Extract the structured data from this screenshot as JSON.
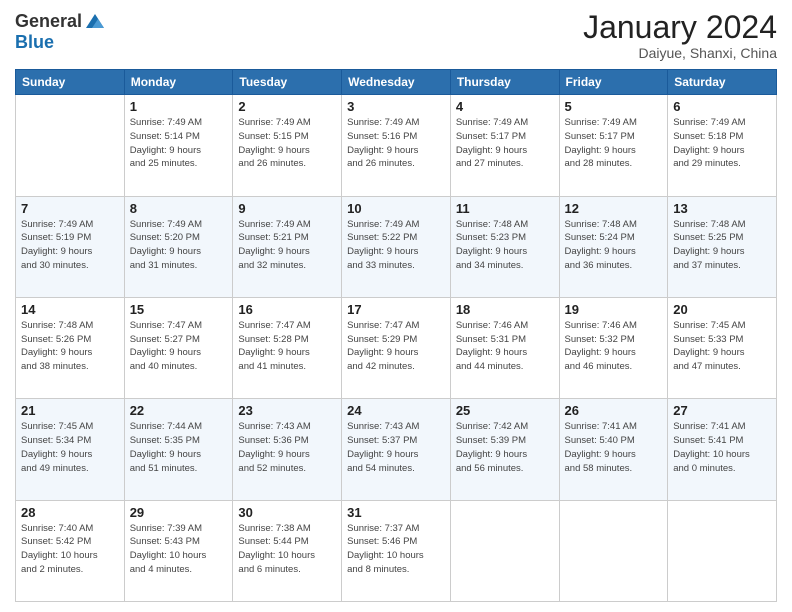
{
  "header": {
    "logo_general": "General",
    "logo_blue": "Blue",
    "month_title": "January 2024",
    "subtitle": "Daiyue, Shanxi, China"
  },
  "days_of_week": [
    "Sunday",
    "Monday",
    "Tuesday",
    "Wednesday",
    "Thursday",
    "Friday",
    "Saturday"
  ],
  "weeks": [
    [
      {
        "day": "",
        "info": ""
      },
      {
        "day": "1",
        "info": "Sunrise: 7:49 AM\nSunset: 5:14 PM\nDaylight: 9 hours\nand 25 minutes."
      },
      {
        "day": "2",
        "info": "Sunrise: 7:49 AM\nSunset: 5:15 PM\nDaylight: 9 hours\nand 26 minutes."
      },
      {
        "day": "3",
        "info": "Sunrise: 7:49 AM\nSunset: 5:16 PM\nDaylight: 9 hours\nand 26 minutes."
      },
      {
        "day": "4",
        "info": "Sunrise: 7:49 AM\nSunset: 5:17 PM\nDaylight: 9 hours\nand 27 minutes."
      },
      {
        "day": "5",
        "info": "Sunrise: 7:49 AM\nSunset: 5:17 PM\nDaylight: 9 hours\nand 28 minutes."
      },
      {
        "day": "6",
        "info": "Sunrise: 7:49 AM\nSunset: 5:18 PM\nDaylight: 9 hours\nand 29 minutes."
      }
    ],
    [
      {
        "day": "7",
        "info": "Sunrise: 7:49 AM\nSunset: 5:19 PM\nDaylight: 9 hours\nand 30 minutes."
      },
      {
        "day": "8",
        "info": "Sunrise: 7:49 AM\nSunset: 5:20 PM\nDaylight: 9 hours\nand 31 minutes."
      },
      {
        "day": "9",
        "info": "Sunrise: 7:49 AM\nSunset: 5:21 PM\nDaylight: 9 hours\nand 32 minutes."
      },
      {
        "day": "10",
        "info": "Sunrise: 7:49 AM\nSunset: 5:22 PM\nDaylight: 9 hours\nand 33 minutes."
      },
      {
        "day": "11",
        "info": "Sunrise: 7:48 AM\nSunset: 5:23 PM\nDaylight: 9 hours\nand 34 minutes."
      },
      {
        "day": "12",
        "info": "Sunrise: 7:48 AM\nSunset: 5:24 PM\nDaylight: 9 hours\nand 36 minutes."
      },
      {
        "day": "13",
        "info": "Sunrise: 7:48 AM\nSunset: 5:25 PM\nDaylight: 9 hours\nand 37 minutes."
      }
    ],
    [
      {
        "day": "14",
        "info": "Sunrise: 7:48 AM\nSunset: 5:26 PM\nDaylight: 9 hours\nand 38 minutes."
      },
      {
        "day": "15",
        "info": "Sunrise: 7:47 AM\nSunset: 5:27 PM\nDaylight: 9 hours\nand 40 minutes."
      },
      {
        "day": "16",
        "info": "Sunrise: 7:47 AM\nSunset: 5:28 PM\nDaylight: 9 hours\nand 41 minutes."
      },
      {
        "day": "17",
        "info": "Sunrise: 7:47 AM\nSunset: 5:29 PM\nDaylight: 9 hours\nand 42 minutes."
      },
      {
        "day": "18",
        "info": "Sunrise: 7:46 AM\nSunset: 5:31 PM\nDaylight: 9 hours\nand 44 minutes."
      },
      {
        "day": "19",
        "info": "Sunrise: 7:46 AM\nSunset: 5:32 PM\nDaylight: 9 hours\nand 46 minutes."
      },
      {
        "day": "20",
        "info": "Sunrise: 7:45 AM\nSunset: 5:33 PM\nDaylight: 9 hours\nand 47 minutes."
      }
    ],
    [
      {
        "day": "21",
        "info": "Sunrise: 7:45 AM\nSunset: 5:34 PM\nDaylight: 9 hours\nand 49 minutes."
      },
      {
        "day": "22",
        "info": "Sunrise: 7:44 AM\nSunset: 5:35 PM\nDaylight: 9 hours\nand 51 minutes."
      },
      {
        "day": "23",
        "info": "Sunrise: 7:43 AM\nSunset: 5:36 PM\nDaylight: 9 hours\nand 52 minutes."
      },
      {
        "day": "24",
        "info": "Sunrise: 7:43 AM\nSunset: 5:37 PM\nDaylight: 9 hours\nand 54 minutes."
      },
      {
        "day": "25",
        "info": "Sunrise: 7:42 AM\nSunset: 5:39 PM\nDaylight: 9 hours\nand 56 minutes."
      },
      {
        "day": "26",
        "info": "Sunrise: 7:41 AM\nSunset: 5:40 PM\nDaylight: 9 hours\nand 58 minutes."
      },
      {
        "day": "27",
        "info": "Sunrise: 7:41 AM\nSunset: 5:41 PM\nDaylight: 10 hours\nand 0 minutes."
      }
    ],
    [
      {
        "day": "28",
        "info": "Sunrise: 7:40 AM\nSunset: 5:42 PM\nDaylight: 10 hours\nand 2 minutes."
      },
      {
        "day": "29",
        "info": "Sunrise: 7:39 AM\nSunset: 5:43 PM\nDaylight: 10 hours\nand 4 minutes."
      },
      {
        "day": "30",
        "info": "Sunrise: 7:38 AM\nSunset: 5:44 PM\nDaylight: 10 hours\nand 6 minutes."
      },
      {
        "day": "31",
        "info": "Sunrise: 7:37 AM\nSunset: 5:46 PM\nDaylight: 10 hours\nand 8 minutes."
      },
      {
        "day": "",
        "info": ""
      },
      {
        "day": "",
        "info": ""
      },
      {
        "day": "",
        "info": ""
      }
    ]
  ]
}
